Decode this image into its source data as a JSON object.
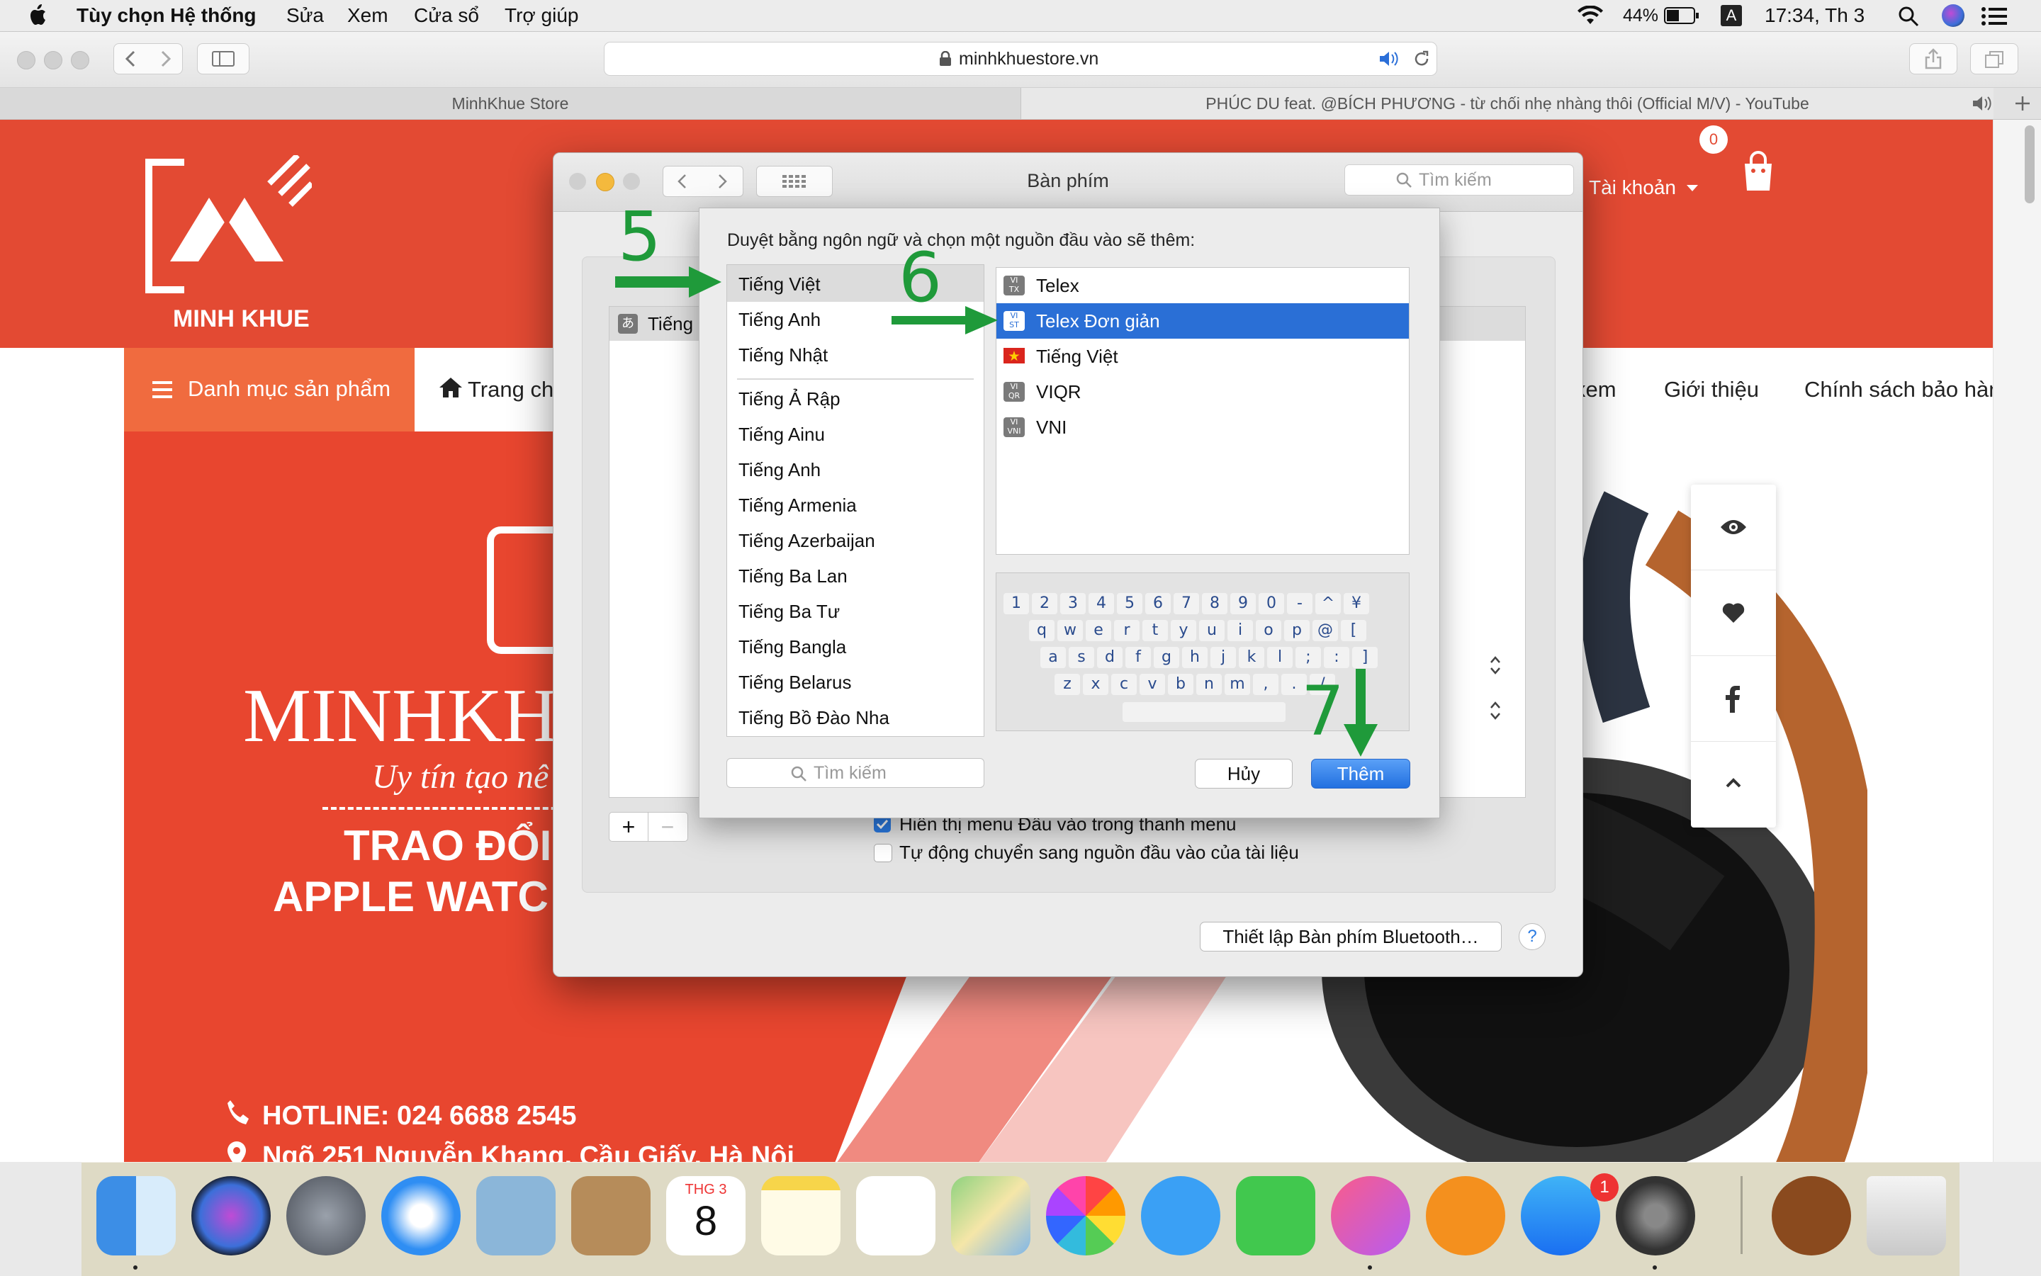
{
  "menubar": {
    "app_name": "Tùy chọn Hệ thống",
    "items": [
      "Sửa",
      "Xem",
      "Cửa sổ",
      "Trợ giúp"
    ],
    "battery": "44%",
    "input_indicator": "A",
    "clock": "17:34, Th 3"
  },
  "browser": {
    "url": "minhkhuestore.vn",
    "tabs": [
      {
        "label": "MinhKhue Store"
      },
      {
        "label": "PHÚC DU feat. @BÍCH PHƯƠNG - từ chối nhẹ nhàng thôi (Official M/V) - YouTube"
      }
    ]
  },
  "site": {
    "logo_text": "MINH KHUE",
    "cart_count": "0",
    "account_label": "Tài khoản",
    "category_button": "Danh mục sản phẩm",
    "nav_links": [
      "Trang ch",
      "xem",
      "Giới thiệu",
      "Chính sách bảo hành"
    ],
    "banner": {
      "brand": "MINHKH",
      "slogan": "Uy tín tạo nê",
      "line1": "TRAO ĐỔI",
      "line2": "APPLE WATC",
      "hotline": "HOTLINE: 024 6688 2545",
      "address": "Ngõ 251 Nguyễn Khang, Cầu Giấy, Hà Nội"
    }
  },
  "prefs_window": {
    "title": "Bàn phím",
    "search_placeholder": "Tìm kiếm",
    "partial_list_item": "Tiếng",
    "checkbox_show_menu": {
      "label": "Hiển thị menu Đầu vào trong thanh menu",
      "checked": true
    },
    "checkbox_auto_switch": {
      "label": "Tự động chuyển sang nguồn đầu vào của tài liệu",
      "checked": false
    },
    "bluetooth_button": "Thiết lập Bàn phím Bluetooth…",
    "help_button": "?",
    "add_button": "+",
    "remove_button": "−"
  },
  "sheet": {
    "description": "Duyệt bằng ngôn ngữ và chọn một nguồn đầu vào sẽ thêm:",
    "languages_top": [
      "Tiếng Việt",
      "Tiếng Anh",
      "Tiếng Nhật"
    ],
    "languages_all": [
      "Tiếng Ả Rập",
      "Tiếng Ainu",
      "Tiếng Anh",
      "Tiếng Armenia",
      "Tiếng Azerbaijan",
      "Tiếng Ba Lan",
      "Tiếng Ba Tư",
      "Tiếng Bangla",
      "Tiếng Belarus",
      "Tiếng Bồ Đào Nha"
    ],
    "selected_language": "Tiếng Việt",
    "sources": [
      {
        "label": "Telex",
        "icon": "VI TX"
      },
      {
        "label": "Telex Đơn giản",
        "icon": "VI ST",
        "selected": true
      },
      {
        "label": "Tiếng Việt",
        "icon": "vietnam-flag"
      },
      {
        "label": "VIQR",
        "icon": "VI QR"
      },
      {
        "label": "VNI",
        "icon": "VI VNI"
      }
    ],
    "keyboard_rows": [
      [
        "1",
        "2",
        "3",
        "4",
        "5",
        "6",
        "7",
        "8",
        "9",
        "0",
        "-",
        "^",
        "¥"
      ],
      [
        "q",
        "w",
        "e",
        "r",
        "t",
        "y",
        "u",
        "i",
        "o",
        "p",
        "@",
        "["
      ],
      [
        "a",
        "s",
        "d",
        "f",
        "g",
        "h",
        "j",
        "k",
        "l",
        ";",
        ":",
        "]"
      ],
      [
        "z",
        "x",
        "c",
        "v",
        "b",
        "n",
        "m",
        ",",
        ".",
        "/"
      ]
    ],
    "search_placeholder": "Tìm kiếm",
    "cancel_button": "Hủy",
    "add_button": "Thêm"
  },
  "annotations": {
    "step5": "5",
    "step6": "6",
    "step7": "7",
    "color": "#1f9a3a"
  },
  "dock": {
    "calendar_month": "THG 3",
    "calendar_day": "8",
    "appstore_badge": "1",
    "apps": [
      "finder",
      "siri",
      "launchpad",
      "safari",
      "preview",
      "contacts",
      "calendar",
      "notes",
      "reminders",
      "maps",
      "photos",
      "messages",
      "facetime",
      "itunes",
      "ibooks",
      "app-store",
      "system-preferences",
      "reeder",
      "trash"
    ]
  }
}
